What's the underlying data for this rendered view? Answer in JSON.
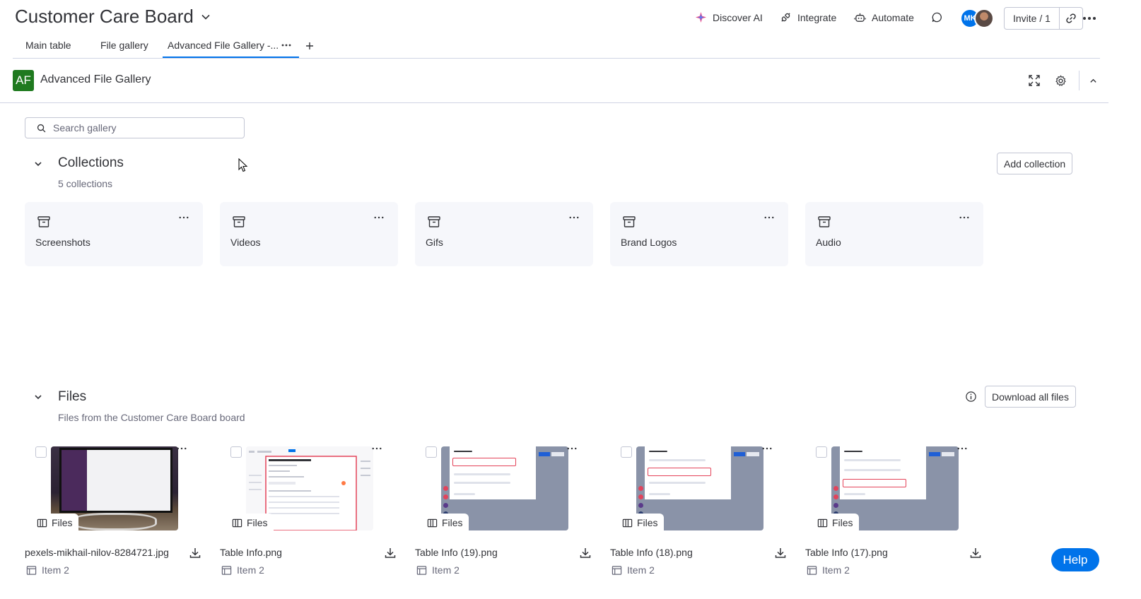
{
  "board": {
    "title": "Customer Care Board"
  },
  "top_actions": {
    "discover_ai": "Discover AI",
    "integrate": "Integrate",
    "automate": "Automate",
    "avatar_initials": "MK",
    "invite": "Invite / 1"
  },
  "tabs": [
    {
      "label": "Main table"
    },
    {
      "label": "File gallery"
    },
    {
      "label": "Advanced File Gallery -..."
    }
  ],
  "widget": {
    "badge": "AF",
    "title": "Advanced File Gallery"
  },
  "search": {
    "placeholder": "Search gallery"
  },
  "collections": {
    "title": "Collections",
    "count_text": "5 collections",
    "add_button": "Add collection",
    "items": [
      {
        "label": "Screenshots"
      },
      {
        "label": "Videos"
      },
      {
        "label": "Gifs"
      },
      {
        "label": "Brand Logos"
      },
      {
        "label": "Audio"
      }
    ]
  },
  "files": {
    "title": "Files",
    "subtitle": "Files from the Customer Care Board board",
    "download_all": "Download all files",
    "items": [
      {
        "name": "pexels-mikhail-nilov-8284721.jpg",
        "chip": "Files",
        "item": "Item 2"
      },
      {
        "name": "Table Info.png",
        "chip": "Files",
        "item": "Item 2"
      },
      {
        "name": "Table Info (19).png",
        "chip": "Files",
        "item": "Item 2"
      },
      {
        "name": "Table Info (18).png",
        "chip": "Files",
        "item": "Item 2"
      },
      {
        "name": "Table Info (17).png",
        "chip": "Files",
        "item": "Item 2"
      }
    ]
  },
  "help": {
    "label": "Help"
  },
  "colors": {
    "accent": "#0073ea",
    "badge": "#1f7a1f",
    "text": "#323338",
    "muted": "#676879"
  }
}
